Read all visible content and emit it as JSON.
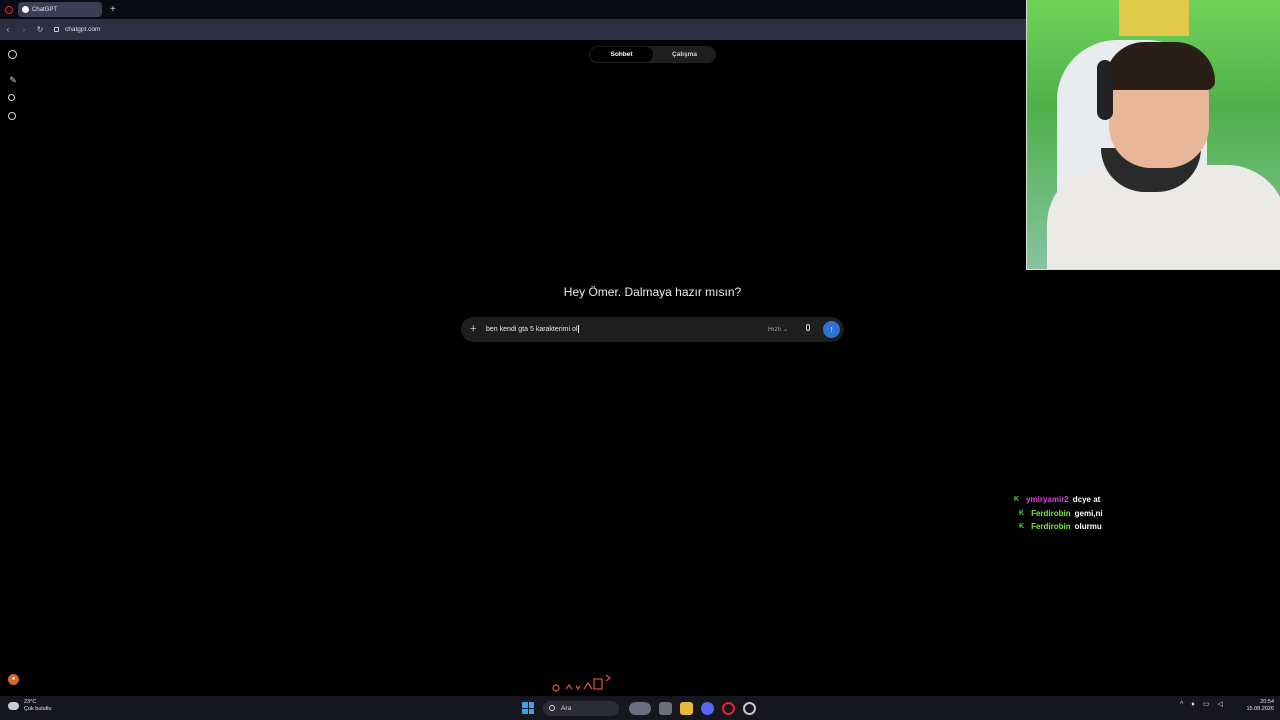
{
  "browser": {
    "tab_title": "ChatGPT",
    "new_tab_label": "+",
    "url": "chatgpt.com"
  },
  "mode_toggle": {
    "chat_label": "Sohbet",
    "work_label": "Çalışma"
  },
  "main": {
    "greeting": "Hey Ömer. Dalmaya hazır mısın?"
  },
  "composer": {
    "prompt_value": "ben kendi  gta 5 karakterimi ol",
    "model_label": "Hızlı"
  },
  "chat_overlay": {
    "messages": [
      {
        "user": "ymiryamir2",
        "user_color": "#e040d8",
        "text": "dcye at"
      },
      {
        "user": "Ferdirobin",
        "user_color": "#7bea3a",
        "text": "gemi,ni"
      },
      {
        "user": "Ferdirobin",
        "user_color": "#7bea3a",
        "text": "olurmu"
      }
    ]
  },
  "taskbar": {
    "weather_temp": "23°C",
    "weather_desc": "Çok bulutlu",
    "search_placeholder": "Ara",
    "time": "20:54",
    "date": "15.08.2026"
  },
  "colors": {
    "background": "#000000",
    "accent_send": "#2f73d8",
    "chat_badge": "#4fd84f"
  }
}
